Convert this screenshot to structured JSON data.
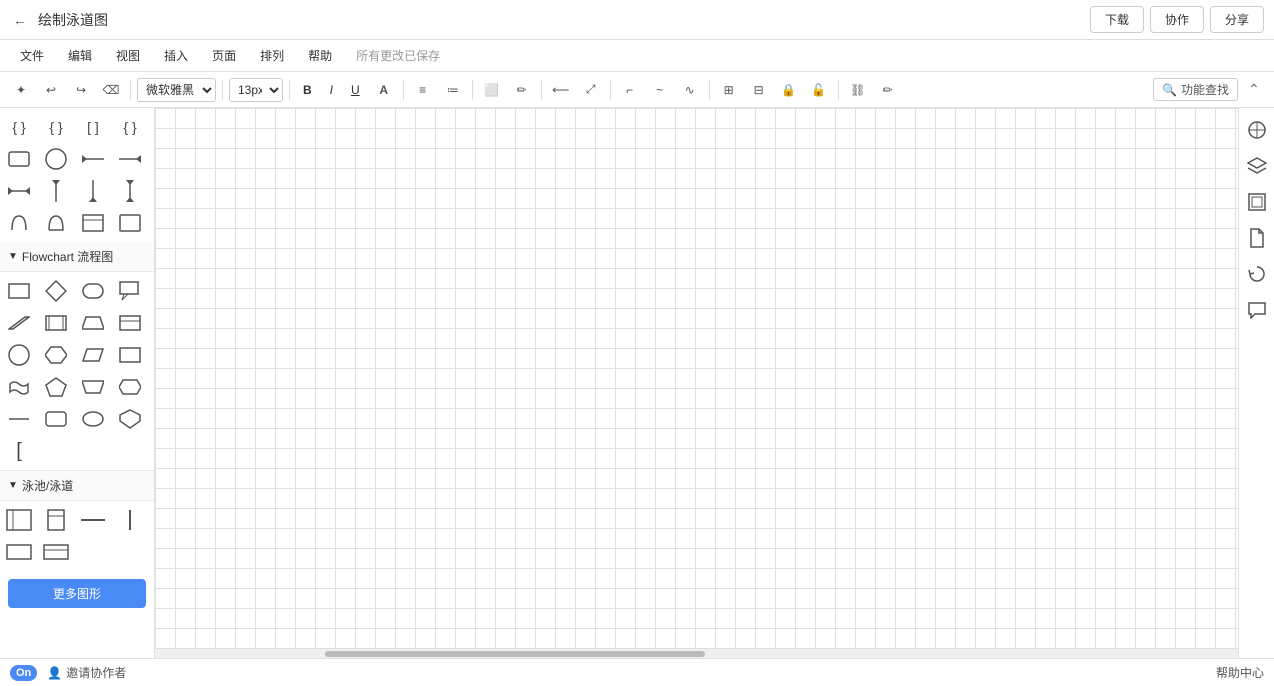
{
  "titleBar": {
    "backIcon": "←",
    "title": "绘制泳道图",
    "downloadLabel": "下载",
    "coopLabel": "协作",
    "shareLabel": "分享"
  },
  "menuBar": {
    "items": [
      "文件",
      "编辑",
      "视图",
      "插入",
      "页面",
      "排列",
      "帮助"
    ],
    "saveStatus": "所有更改已保存"
  },
  "toolbar": {
    "undoIcon": "↩",
    "redoIcon": "↪",
    "clearIcon": "⌫",
    "fontFamily": "微软雅黑",
    "fontSize": "13px",
    "boldLabel": "B",
    "italicLabel": "I",
    "underlineLabel": "U",
    "fontColorLabel": "A",
    "fillColorLabel": "🪣",
    "listIcon1": "≡",
    "listIcon2": "≔",
    "linkIcon": "⛓",
    "searchLabel": "功能查找",
    "collapseIcon": "⌃"
  },
  "leftPanel": {
    "sections": [
      {
        "id": "misc-shapes",
        "header": "",
        "shapes": [
          "{ }",
          "{ }",
          "{ }",
          "{ }",
          "□",
          "○",
          "⟵",
          "⟶",
          "↔",
          "↑",
          "↓",
          "↕",
          "∪",
          "∩",
          "⌐",
          "▭"
        ]
      },
      {
        "id": "flowchart",
        "header": "Flowchart 流程图",
        "shapes": [
          "□",
          "◇",
          "⬠",
          "⬜",
          "▱",
          "▭",
          "▯",
          "▤",
          "◁",
          "▷",
          "⊏",
          "⊐",
          "○",
          "⬡",
          "⬢",
          "▭",
          "⌣",
          "⬡",
          "⬢",
          "⌢",
          "−",
          "□",
          "○",
          "⬟",
          "["
        ]
      },
      {
        "id": "swimlane",
        "header": "泳池/泳道",
        "shapes": [
          "▦",
          "▧",
          "—",
          "|",
          "▭",
          "▭"
        ]
      }
    ],
    "moreShapesLabel": "更多图形"
  },
  "rightPanel": {
    "buttons": [
      {
        "id": "compass",
        "icon": "✛",
        "label": "compass-icon"
      },
      {
        "id": "layers",
        "icon": "⊞",
        "label": "layers-icon"
      },
      {
        "id": "frame",
        "icon": "⊟",
        "label": "frame-icon"
      },
      {
        "id": "document",
        "icon": "📄",
        "label": "document-icon"
      },
      {
        "id": "history",
        "icon": "↺",
        "label": "history-icon"
      },
      {
        "id": "comment",
        "icon": "💬",
        "label": "comment-icon"
      }
    ]
  },
  "statusBar": {
    "onLabel": "On",
    "inviteIcon": "👤",
    "inviteLabel": "邀请协作者",
    "helpLabel": "帮助中心"
  }
}
